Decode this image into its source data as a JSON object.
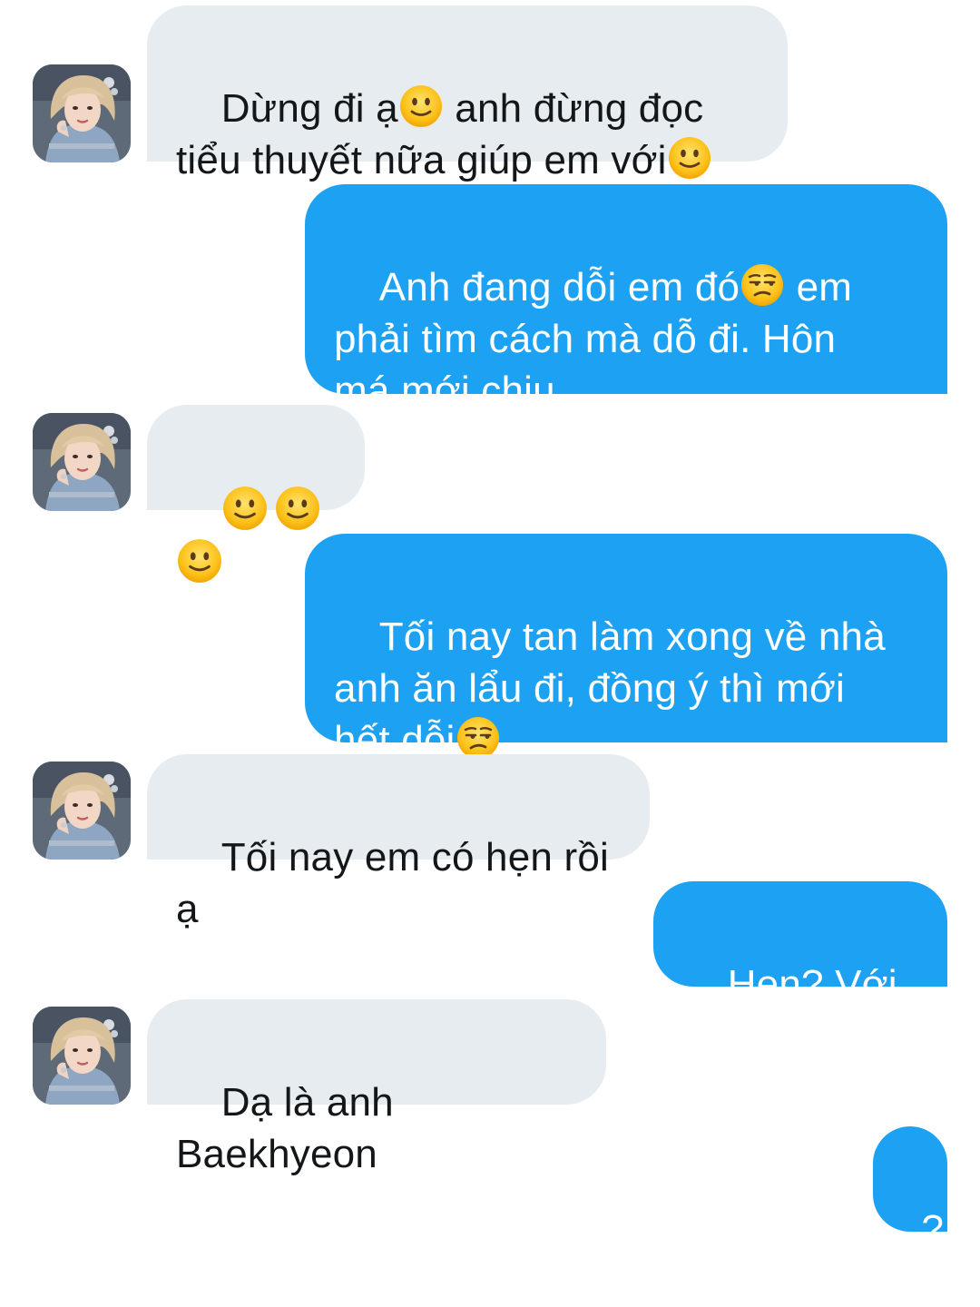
{
  "conversation": {
    "messages": [
      {
        "side": "in",
        "parts": [
          "Dừng đi ạ",
          "anh đừng đọc",
          "tiểu thuyết nữa giúp em với"
        ],
        "icons": [
          "slightly-smiling-face-icon",
          "slightly-smiling-face-icon"
        ]
      },
      {
        "side": "out",
        "parts": [
          "Anh đang dỗi em đó",
          "em",
          "phải tìm cách mà dỗ đi. Hôn",
          "má mới chịu"
        ],
        "icons": [
          "unamused-face-icon"
        ]
      },
      {
        "side": "in",
        "parts": [],
        "icons": [
          "slightly-smiling-face-icon",
          "slightly-smiling-face-icon",
          "slightly-smiling-face-icon"
        ]
      },
      {
        "side": "out",
        "parts": [
          "Tối nay tan làm xong về nhà",
          "anh ăn lẩu đi, đồng ý thì mới",
          "hết dỗi"
        ],
        "icons": [
          "unamused-face-icon"
        ]
      },
      {
        "side": "in",
        "parts": [
          "Tối nay em có hẹn rồi ạ"
        ],
        "icons": []
      },
      {
        "side": "out",
        "parts": [
          "Hẹn? Với ai?"
        ],
        "icons": []
      },
      {
        "side": "in",
        "parts": [
          "Dạ là anh Baekhyeon"
        ],
        "icons": []
      },
      {
        "side": "out",
        "parts": [
          "?"
        ],
        "icons": []
      }
    ]
  },
  "colors": {
    "incoming_bubble": "#e6ecf0",
    "outgoing_bubble": "#1da1f2",
    "incoming_text": "#14171a",
    "outgoing_text": "#ffffff",
    "background": "#ffffff"
  }
}
